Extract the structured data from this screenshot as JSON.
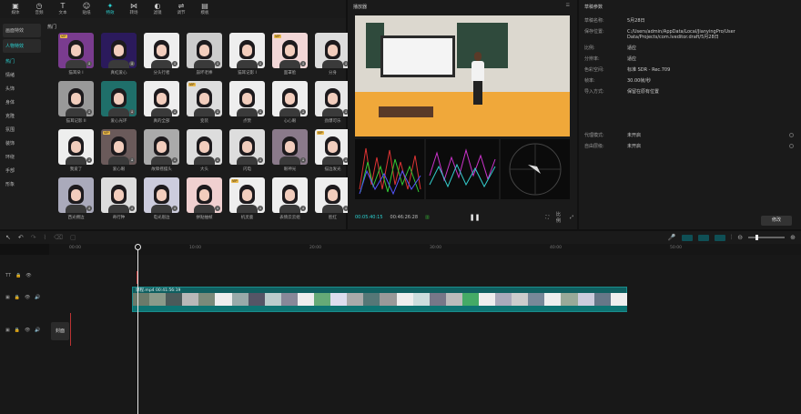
{
  "topbar": {
    "items": [
      {
        "label": "媒体",
        "icon": "media-icon"
      },
      {
        "label": "音频",
        "icon": "audio-icon"
      },
      {
        "label": "文本",
        "icon": "text-icon"
      },
      {
        "label": "贴纸",
        "icon": "sticker-icon"
      },
      {
        "label": "特效",
        "icon": "effects-icon",
        "active": true
      },
      {
        "label": "转场",
        "icon": "transition-icon"
      },
      {
        "label": "滤镜",
        "icon": "filter-icon"
      },
      {
        "label": "调节",
        "icon": "adjust-icon"
      },
      {
        "label": "模板",
        "icon": "template-icon"
      }
    ]
  },
  "sidebar": {
    "group1": "画面特效",
    "group2": "人物特效",
    "items": [
      "热门",
      "情绪",
      "头饰",
      "身体",
      "克隆",
      "氛围",
      "装饰",
      "环绕",
      "手部",
      "形象"
    ]
  },
  "grid": {
    "section": "热门",
    "items": [
      "猫耳朵 I",
      "真虹爱心",
      "分头行者",
      "崩坏老棒",
      "猫耳记影 I",
      "面罩脸",
      "分身",
      "猫耳记影 II",
      "爱心光环",
      "真的全部",
      "变装",
      "点赞",
      "心心眼",
      "劲爆可乐",
      "我爱了",
      "爱心眼",
      "故障摇摆头",
      "大头",
      "闪电",
      "眼神光",
      "描边发光",
      "西光拥边",
      "奇行种",
      "电光眉边",
      "拼贴抽帧",
      "机灵鹿",
      "表情云云组",
      "脸红"
    ]
  },
  "player": {
    "title": "播放器",
    "current_time": "00:05:40:15",
    "total_time": "00:46:26:28",
    "ratio_label": "比例"
  },
  "props": {
    "title": "草稿参数",
    "rows": [
      {
        "k": "草稿名称:",
        "v": "5月28日"
      },
      {
        "k": "保存位置:",
        "v": "C:/Users/admin/AppData/Local/JianyingPro/User Data/Projects/com.lveditor.draft/5月28日"
      },
      {
        "k": "比例:",
        "v": "适应"
      },
      {
        "k": "分辨率:",
        "v": "适应"
      },
      {
        "k": "色彩空间:",
        "v": "标准 SDR - Rec.709"
      },
      {
        "k": "帧率:",
        "v": "30.00帧/秒"
      },
      {
        "k": "导入方式:",
        "v": "保留在原有位置"
      }
    ],
    "rows2": [
      {
        "k": "代理模式:",
        "v": "未开启"
      },
      {
        "k": "自由层级:",
        "v": "未开启"
      }
    ],
    "edit": "修改"
  },
  "timeline": {
    "ticks": [
      "00:00",
      "10:00",
      "20:00",
      "30:00",
      "40:00",
      "50:00"
    ],
    "clip_label": "课程.mp4   00:41:56:19",
    "cover": "封面"
  },
  "colors": {
    "accent": "#2bd0d0",
    "clip": "#0f5f60"
  }
}
